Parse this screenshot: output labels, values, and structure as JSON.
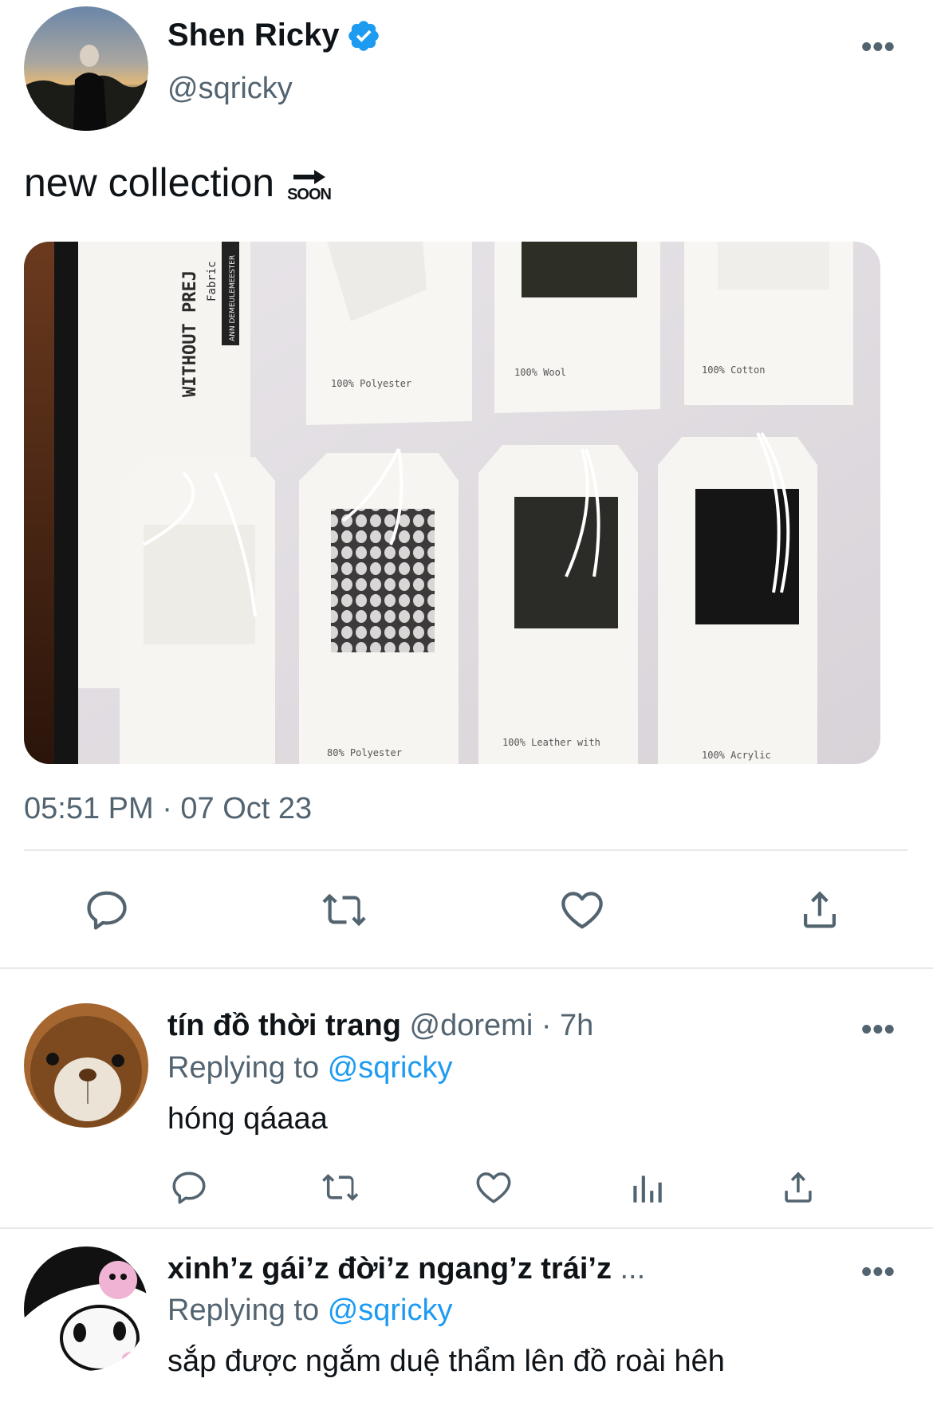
{
  "main_tweet": {
    "author": {
      "display_name": "Shen Ricky",
      "handle": "@sqricky",
      "verified": true
    },
    "text": "new collection",
    "emoji": {
      "icon": "soon-arrow-icon",
      "label": "SOON"
    },
    "media": {
      "description_icon": "fabric-swatch-tags-photo",
      "panel_text": [
        "WITHOUT PREJ",
        "Fabric",
        "ANN DEMEULEMEESTER"
      ],
      "tag_labels": [
        "100% Polyester",
        "100% Wool",
        "100% Cotton",
        "80% Polyester",
        "100% Leather with",
        "100% Acrylic"
      ]
    },
    "timestamp": "05:51 PM · 07 Oct 23",
    "actions": [
      "reply-icon",
      "retweet-icon",
      "like-icon",
      "share-icon"
    ]
  },
  "replies": [
    {
      "display_name": "tín đồ thời trang",
      "handle_time": "@doremi · 7h",
      "replying_prefix": "Replying to",
      "replying_to": "@sqricky",
      "text": "hóng qáaaa",
      "actions": [
        "reply-icon",
        "retweet-icon",
        "like-icon",
        "analytics-icon",
        "share-icon"
      ]
    },
    {
      "display_name": "xinh’z gái’z đời’z ngang’z trái’z",
      "ellipsis": "...",
      "replying_prefix": "Replying to",
      "replying_to": "@sqricky",
      "text": "sắp được ngắm duệ thẩm lên đồ roài hêh"
    }
  ],
  "more_label": "•••",
  "colors": {
    "text_primary": "#0f1419",
    "text_secondary": "#536471",
    "link": "#1d9bf0",
    "verified": "#1d9bf0",
    "divider": "#e7e9ea"
  }
}
